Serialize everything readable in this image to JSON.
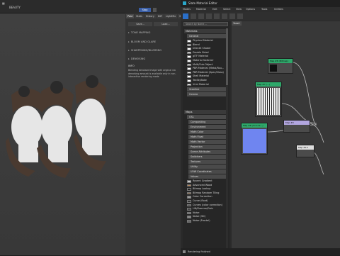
{
  "render_window": {
    "title": "BEAUTY"
  },
  "frame_buffer": {
    "tabs": [
      "Post",
      "Stats",
      "History",
      "Diff",
      "LightMix",
      "Stamp"
    ],
    "buttons": [
      "Save...",
      "Load..."
    ],
    "sections": [
      "TONE MAPPING",
      "BLOOM AND GLARE",
      "SHARPENING/BLURRING",
      "DENOISING"
    ],
    "info_label": "INFO",
    "info_text": "Blending denoised image with original via denoising amount is available only in non-interactive rendering mode"
  },
  "slate": {
    "title": "Slate Material Editor",
    "menus": [
      "Modes",
      "Material",
      "Edit",
      "Select",
      "View",
      "Options",
      "Tools",
      "Utilities"
    ],
    "view_tab": "View1",
    "search_placeholder": "Search by Name ...",
    "materials_header": "Materials",
    "general_group": "General",
    "materials": [
      "Physical Material",
      "Blend",
      "DirectX Shader",
      "Double Sided",
      "glTF Material",
      "Material Switcher",
      "Multi/Sub-Object",
      "PBR Material (Metal/Rou...",
      "PBR Material (Spec/Gloss)",
      "Shell Material",
      "TexSkyBake",
      "Vrml Material"
    ],
    "material_groups": [
      "Scanline",
      "Corona"
    ],
    "maps_header": "Maps",
    "osl_group": "OSL",
    "osl_items": [
      "Compositing",
      "Environment",
      "Math Color",
      "Math Float",
      "Math Vector",
      "Projection",
      "Scene Attributes",
      "Switchers",
      "Textures",
      "Utility",
      "UVW Coordinates",
      "Values"
    ],
    "maps": [
      "Ryvent Gradient",
      "Advanced Wood",
      "Bitmap Lookup",
      "Bitmap Random Tiling",
      "Color Correction",
      "Curve (float)",
      "Curves (color correction)",
      "Lift/Gamma/Gain",
      "Noise",
      "Noise (3D)",
      "Noise (Fractal)"
    ],
    "status": "Rendering finished",
    "nodes": [
      {
        "id": "map1",
        "label": "Map #8 (Bitmap)"
      },
      {
        "id": "map2",
        "label": "Map #7 (...)"
      },
      {
        "id": "mat",
        "label": "Map #8 (Corona...)"
      },
      {
        "id": "map3",
        "label": "Map #9"
      },
      {
        "id": "map4",
        "label": "Map #10"
      }
    ]
  }
}
